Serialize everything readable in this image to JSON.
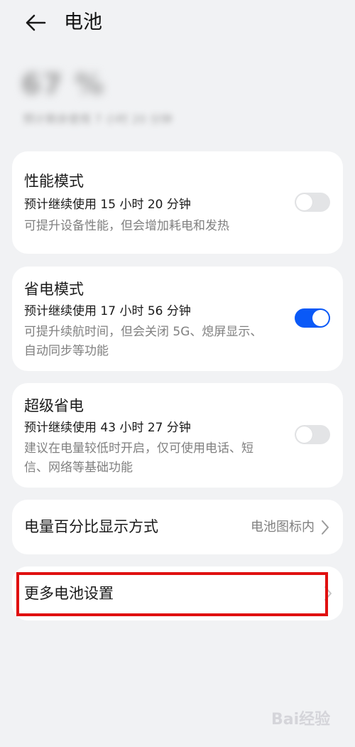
{
  "header": {
    "title": "电池"
  },
  "battery_summary": {
    "level": "67 %",
    "remaining": "预计剩余使用 7 小时 20 分钟"
  },
  "modes": [
    {
      "title": "性能模式",
      "estimate": "预计继续使用 15 小时 20 分钟",
      "description": "可提升设备性能，但会增加耗电和发热",
      "enabled": false
    },
    {
      "title": "省电模式",
      "estimate": "预计继续使用 17 小时 56 分钟",
      "description": "可提升续航时间，但会关闭 5G、熄屏显示、自动同步等功能",
      "enabled": true
    },
    {
      "title": "超级省电",
      "estimate": "预计继续使用 43 小时 27 分钟",
      "description": "建议在电量较低时开启，仅可使用电话、短信、网络等基础功能",
      "enabled": false
    }
  ],
  "percentage_row": {
    "label": "电量百分比显示方式",
    "value": "电池图标内"
  },
  "more_row": {
    "label": "更多电池设置"
  },
  "watermark": {
    "text": "Bai经验"
  },
  "colors": {
    "accent": "#0a59f7",
    "highlight": "#e01010",
    "background": "#f1f2f4"
  }
}
